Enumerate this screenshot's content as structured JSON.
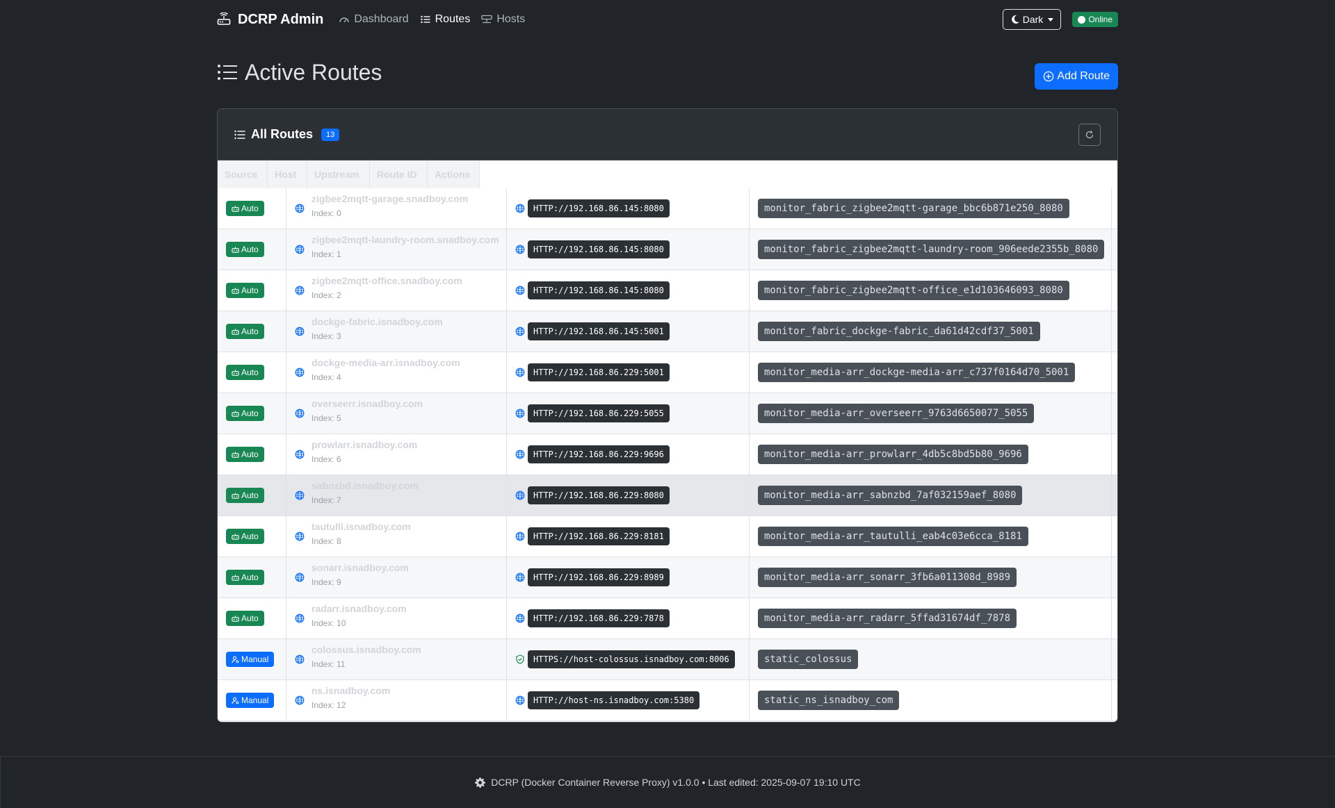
{
  "nav": {
    "brand": "DCRP Admin",
    "links": [
      {
        "label": "Dashboard",
        "active": false
      },
      {
        "label": "Routes",
        "active": true
      },
      {
        "label": "Hosts",
        "active": false
      }
    ],
    "theme_label": "Dark",
    "status_label": "Online"
  },
  "page": {
    "title": "Active Routes",
    "add_button": "Add Route"
  },
  "card": {
    "title": "All Routes",
    "count": "13"
  },
  "table": {
    "columns": [
      "Source",
      "Host",
      "Upstream",
      "Route ID",
      "Actions"
    ],
    "rows": [
      {
        "source": "Auto",
        "host": "zigbee2mqtt-garage.snadboy.com",
        "index": "Index: 0",
        "upstream": "HTTP://192.168.86.145:8080",
        "secure": false,
        "route_id": "monitor_fabric_zigbee2mqtt-garage_bbc6b871e250_8080"
      },
      {
        "source": "Auto",
        "host": "zigbee2mqtt-laundry-room.snadboy.com",
        "index": "Index: 1",
        "upstream": "HTTP://192.168.86.145:8080",
        "secure": false,
        "route_id": "monitor_fabric_zigbee2mqtt-laundry-room_906eede2355b_8080"
      },
      {
        "source": "Auto",
        "host": "zigbee2mqtt-office.snadboy.com",
        "index": "Index: 2",
        "upstream": "HTTP://192.168.86.145:8080",
        "secure": false,
        "route_id": "monitor_fabric_zigbee2mqtt-office_e1d103646093_8080"
      },
      {
        "source": "Auto",
        "host": "dockge-fabric.isnadboy.com",
        "index": "Index: 3",
        "upstream": "HTTP://192.168.86.145:5001",
        "secure": false,
        "route_id": "monitor_fabric_dockge-fabric_da61d42cdf37_5001"
      },
      {
        "source": "Auto",
        "host": "dockge-media-arr.isnadboy.com",
        "index": "Index: 4",
        "upstream": "HTTP://192.168.86.229:5001",
        "secure": false,
        "route_id": "monitor_media-arr_dockge-media-arr_c737f0164d70_5001"
      },
      {
        "source": "Auto",
        "host": "overseerr.isnadboy.com",
        "index": "Index: 5",
        "upstream": "HTTP://192.168.86.229:5055",
        "secure": false,
        "route_id": "monitor_media-arr_overseerr_9763d6650077_5055"
      },
      {
        "source": "Auto",
        "host": "prowlarr.isnadboy.com",
        "index": "Index: 6",
        "upstream": "HTTP://192.168.86.229:9696",
        "secure": false,
        "route_id": "monitor_media-arr_prowlarr_4db5c8bd5b80_9696"
      },
      {
        "source": "Auto",
        "host": "sabnzbd.isnadboy.com",
        "index": "Index: 7",
        "upstream": "HTTP://192.168.86.229:8080",
        "secure": false,
        "route_id": "monitor_media-arr_sabnzbd_7af032159aef_8080"
      },
      {
        "source": "Auto",
        "host": "tautulli.isnadboy.com",
        "index": "Index: 8",
        "upstream": "HTTP://192.168.86.229:8181",
        "secure": false,
        "route_id": "monitor_media-arr_tautulli_eab4c03e6cca_8181"
      },
      {
        "source": "Auto",
        "host": "sonarr.isnadboy.com",
        "index": "Index: 9",
        "upstream": "HTTP://192.168.86.229:8989",
        "secure": false,
        "route_id": "monitor_media-arr_sonarr_3fb6a011308d_8989"
      },
      {
        "source": "Auto",
        "host": "radarr.isnadboy.com",
        "index": "Index: 10",
        "upstream": "HTTP://192.168.86.229:7878",
        "secure": false,
        "route_id": "monitor_media-arr_radarr_5ffad31674df_7878"
      },
      {
        "source": "Manual",
        "host": "colossus.isnadboy.com",
        "index": "Index: 11",
        "upstream": "HTTPS://host-colossus.isnadboy.com:8006",
        "secure": true,
        "route_id": "static_colossus"
      },
      {
        "source": "Manual",
        "host": "ns.isnadboy.com",
        "index": "Index: 12",
        "upstream": "HTTP://host-ns.isnadboy.com:5380",
        "secure": false,
        "route_id": "static_ns_isnadboy_com"
      }
    ]
  },
  "footer": {
    "text": "DCRP (Docker Container Reverse Proxy) v1.0.0 • Last edited: 2025-09-07 19:10 UTC"
  },
  "colors": {
    "auto": "#198754",
    "manual": "#0d6efd",
    "globe": "#0d6efd",
    "shield": "#198754"
  }
}
